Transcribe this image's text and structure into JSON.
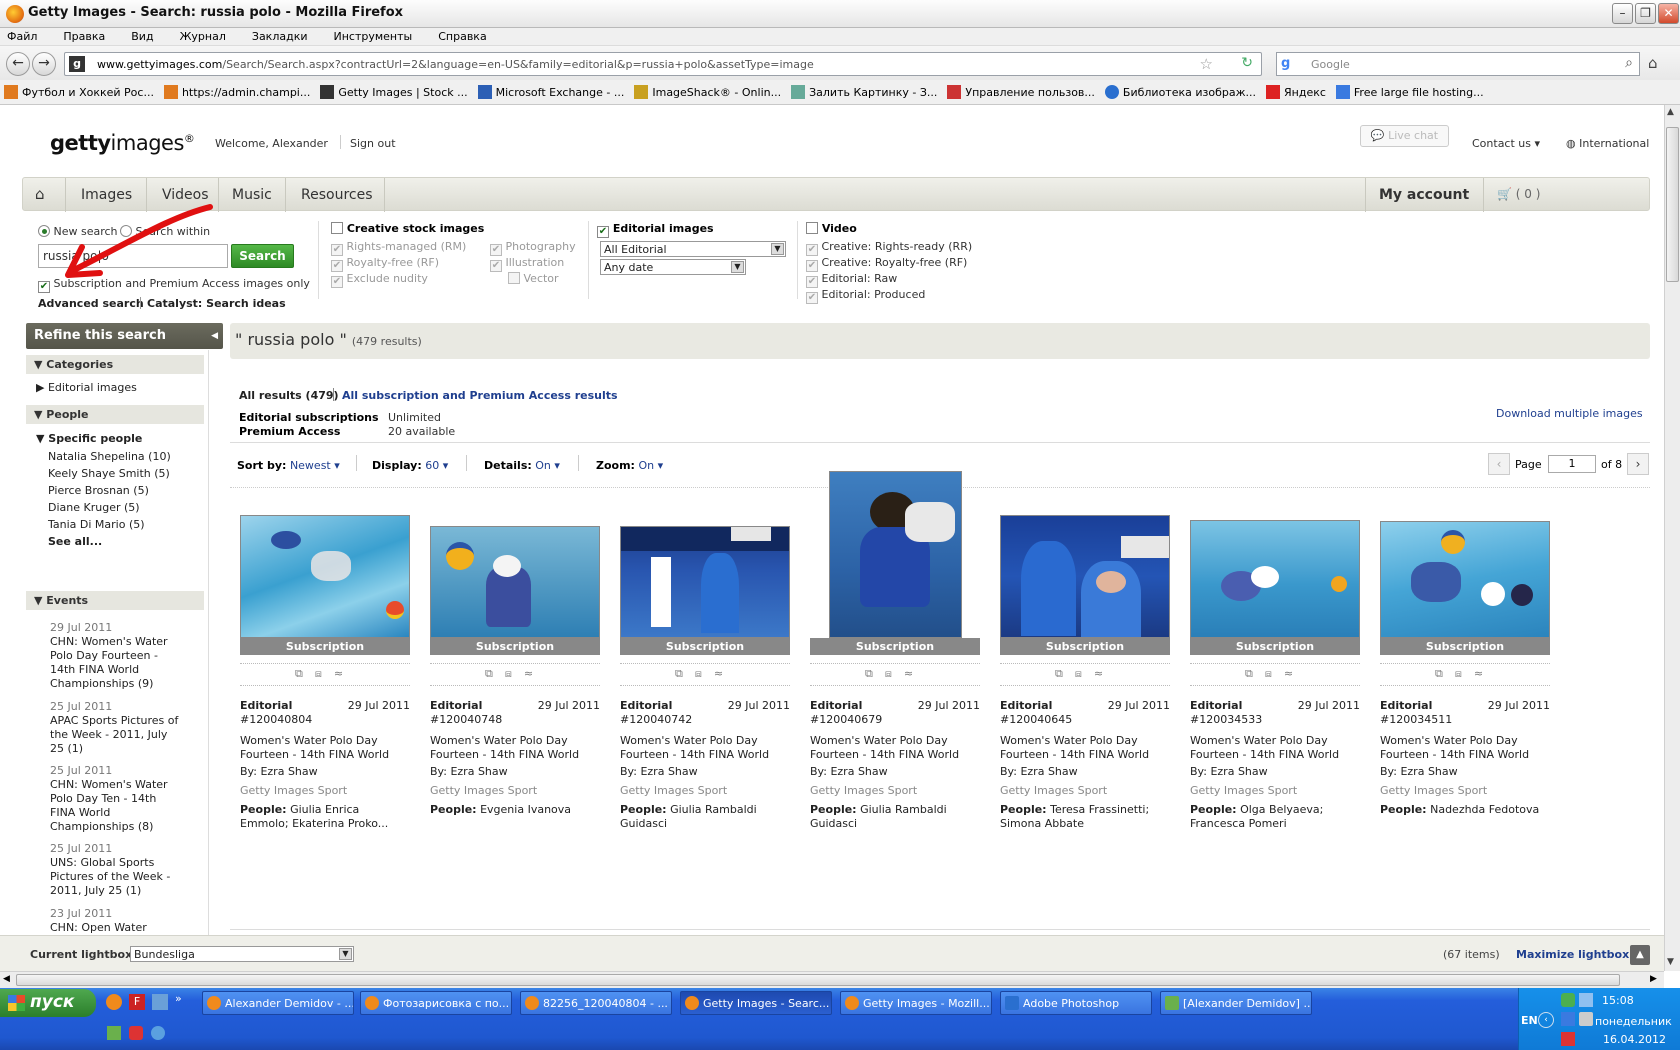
{
  "window": {
    "title": "Getty Images - Search: russia polo - Mozilla Firefox"
  },
  "menu": [
    "Файл",
    "Правка",
    "Вид",
    "Журнал",
    "Закладки",
    "Инструменты",
    "Справка"
  ],
  "address": {
    "domain": "www.gettyimages.com",
    "path": "/Search/Search.aspx?contractUrl=2&language=en-US&family=editorial&p=russia+polo&assetType=image"
  },
  "search_engine": {
    "placeholder": "Google"
  },
  "bookmarks": [
    "Футбол и Хоккей Рос...",
    "https://admin.champi...",
    "Getty Images | Stock ...",
    "Microsoft Exchange - ...",
    "ImageShack® - Onlin...",
    "Залить Картинку - З...",
    "Управление пользов...",
    "Библиотека изображ...",
    "Яндекс",
    "Free large file hosting..."
  ],
  "header": {
    "logo_a": "getty",
    "logo_b": "images",
    "logo_reg": "®",
    "welcome": "Welcome, Alexander",
    "signout": "Sign out",
    "live_chat": "Live chat",
    "contact": "Contact us",
    "international": "International"
  },
  "mainnav": {
    "items": [
      "Images",
      "Videos",
      "Music",
      "Resources"
    ],
    "my_account": "My account",
    "cart": "( 0 )"
  },
  "search": {
    "new_search": "New search",
    "search_within": "Search within",
    "query": "russia po|o",
    "button": "Search",
    "subscription_only": "Subscription and Premium Access images only",
    "advanced": "Advanced search",
    "catalyst": "Catalyst: Search ideas"
  },
  "filters": {
    "creative": {
      "title": "Creative stock images",
      "rm": "Rights-managed (RM)",
      "rf": "Royalty-free (RF)",
      "nudity": "Exclude nudity",
      "photo": "Photography",
      "illus": "Illustration",
      "vector": "Vector"
    },
    "editorial": {
      "title": "Editorial images",
      "collection": "All Editorial",
      "date": "Any date"
    },
    "video": {
      "title": "Video",
      "items": [
        "Creative: Rights-ready (RR)",
        "Creative: Royalty-free (RF)",
        "Editorial: Raw",
        "Editorial: Produced"
      ]
    }
  },
  "sidebar": {
    "refine": "Refine this search",
    "categories": "Categories",
    "editorial_images": "Editorial images",
    "people": "People",
    "specific_people": "Specific people",
    "people_list": [
      "Natalia Shepelina (10)",
      "Keely Shaye Smith (5)",
      "Pierce Brosnan (5)",
      "Diane Kruger (5)",
      "Tania Di Mario (5)"
    ],
    "see_all": "See all...",
    "events": "Events",
    "event_list": [
      {
        "date": "29 Jul 2011",
        "title": "CHN: Women's Water Polo Day Fourteen - 14th FINA World Championships (9)"
      },
      {
        "date": "25 Jul 2011",
        "title": "APAC Sports Pictures of the Week - 2011, July 25 (1)"
      },
      {
        "date": "25 Jul 2011",
        "title": "CHN: Women's Water Polo Day Ten - 14th FINA World Championships (8)"
      },
      {
        "date": "25 Jul 2011",
        "title": "UNS: Global Sports Pictures of the Week - 2011, July 25 (1)"
      },
      {
        "date": "23 Jul 2011",
        "title": "CHN: Open Water"
      }
    ]
  },
  "results": {
    "query": "\" russia polo \"",
    "count": "(479 results)",
    "all_results": "All results (479)",
    "all_sub": "All subscription and Premium Access results",
    "sub_label": "Editorial subscriptions",
    "sub_value": "Unlimited",
    "pa_label": "Premium Access",
    "pa_value": "20 available",
    "download_multi": "Download multiple images",
    "sort_label": "Sort by:",
    "sort_value": "Newest",
    "display_label": "Display:",
    "display_value": "60",
    "details_label": "Details:",
    "details_value": "On",
    "zoom_label": "Zoom:",
    "zoom_value": "On",
    "page_label": "Page",
    "page_value": "1",
    "page_of": "of 8"
  },
  "cards": [
    {
      "badge": "Subscription",
      "type": "Editorial",
      "date": "29 Jul 2011",
      "id": "#120040804",
      "title": "Women's Water Polo Day Fourteen - 14th FINA World",
      "by": "By: Ezra Shaw",
      "collection": "Getty Images Sport",
      "people_label": "People:",
      "people": "Giulia Enrica Emmolo; Ekaterina Proko..."
    },
    {
      "badge": "Subscription",
      "type": "Editorial",
      "date": "29 Jul 2011",
      "id": "#120040748",
      "title": "Women's Water Polo Day Fourteen - 14th FINA World",
      "by": "By: Ezra Shaw",
      "collection": "Getty Images Sport",
      "people_label": "People:",
      "people": "Evgenia Ivanova"
    },
    {
      "badge": "Subscription",
      "type": "Editorial",
      "date": "29 Jul 2011",
      "id": "#120040742",
      "title": "Women's Water Polo Day Fourteen - 14th FINA World",
      "by": "By: Ezra Shaw",
      "collection": "Getty Images Sport",
      "people_label": "People:",
      "people": "Giulia Rambaldi Guidasci"
    },
    {
      "badge": "Subscription",
      "type": "Editorial",
      "date": "29 Jul 2011",
      "id": "#120040679",
      "title": "Women's Water Polo Day Fourteen - 14th FINA World",
      "by": "By: Ezra Shaw",
      "collection": "Getty Images Sport",
      "people_label": "People:",
      "people": "Giulia Rambaldi Guidasci"
    },
    {
      "badge": "Subscription",
      "type": "Editorial",
      "date": "29 Jul 2011",
      "id": "#120040645",
      "title": "Women's Water Polo Day Fourteen - 14th FINA World",
      "by": "By: Ezra Shaw",
      "collection": "Getty Images Sport",
      "people_label": "People:",
      "people": "Teresa Frassinetti; Simona Abbate"
    },
    {
      "badge": "Subscription",
      "type": "Editorial",
      "date": "29 Jul 2011",
      "id": "#120034533",
      "title": "Women's Water Polo Day Fourteen - 14th FINA World",
      "by": "By: Ezra Shaw",
      "collection": "Getty Images Sport",
      "people_label": "People:",
      "people": "Olga Belyaeva; Francesca Pomeri"
    },
    {
      "badge": "Subscription",
      "type": "Editorial",
      "date": "29 Jul 2011",
      "id": "#120034511",
      "title": "Women's Water Polo Day Fourteen - 14th FINA World",
      "by": "By: Ezra Shaw",
      "collection": "Getty Images Sport",
      "people_label": "People:",
      "people": "Nadezhda Fedotova"
    }
  ],
  "lightbox": {
    "label": "Current lightbox:",
    "value": "Bundesliga",
    "count": "(67 items)",
    "maximize": "Maximize lightbox"
  },
  "taskbar": {
    "start": "пуск",
    "items": [
      "Alexander Demidov - ...",
      "Фотозарисовка с по...",
      "82256_120040804 - ...",
      "Getty Images - Searc...",
      "Getty Images - Mozill...",
      "Adobe Photoshop",
      "[Alexander Demidov] ..."
    ],
    "lang": "EN",
    "time": "15:08",
    "day": "понедельник",
    "date": "16.04.2012"
  },
  "colors": {
    "accent_green": "#2e8a25",
    "link_blue": "#1f3f8f",
    "nav_bg": "#e4e4dc",
    "taskbar_blue": "#245edb"
  }
}
